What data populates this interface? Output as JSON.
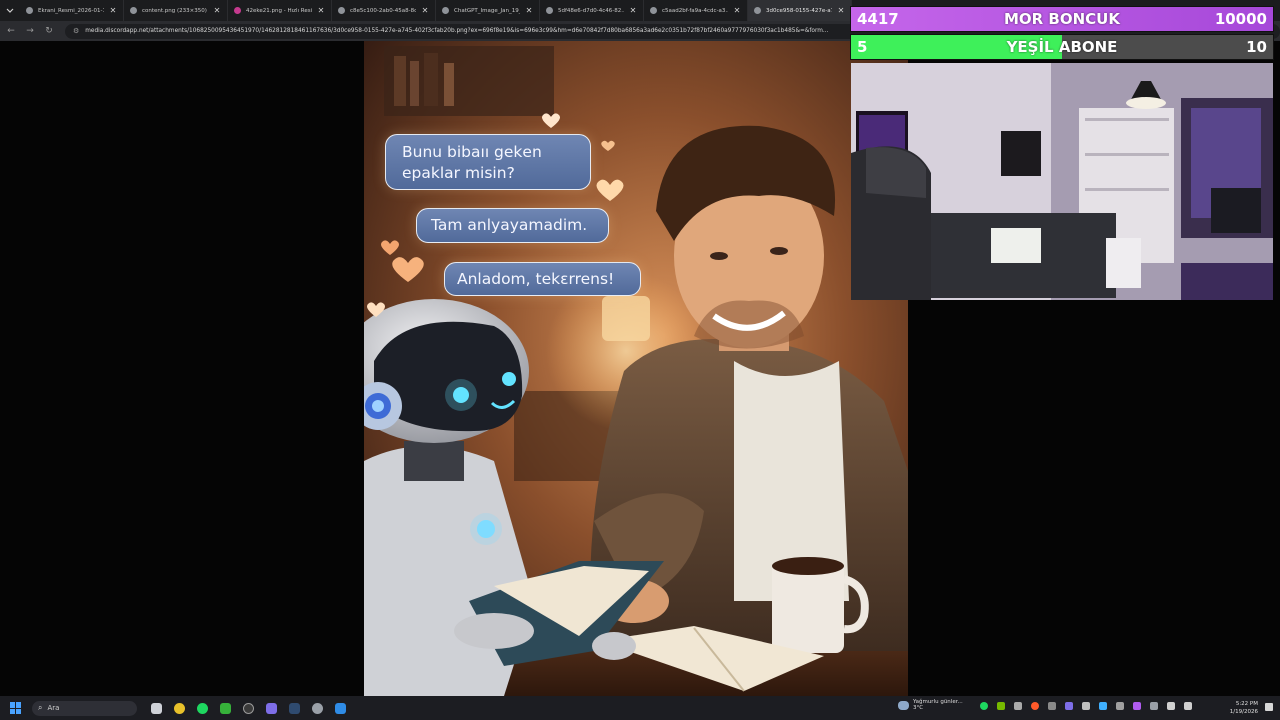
{
  "browser": {
    "tabs": [
      {
        "title": "Ekrani_Resmi_2026-01-19_...",
        "favicon_color": "#8f9399"
      },
      {
        "title": "content.png (233×350)",
        "favicon_color": "#8f9399"
      },
      {
        "title": "42eke21.png - Hızlı Resim",
        "favicon_color": "#c53a8e"
      },
      {
        "title": "c8e5c100-2ab0-45a8-8c...",
        "favicon_color": "#8f9399"
      },
      {
        "title": "ChatGPT_Image_Jan_19_...",
        "favicon_color": "#8f9399"
      },
      {
        "title": "5df48e6-d7d0-4c46-82...",
        "favicon_color": "#8f9399"
      },
      {
        "title": "c5aad2bf-fa9a-4cdc-a3...",
        "favicon_color": "#8f9399"
      },
      {
        "title": "3d0ce958-0155-427e-a7...",
        "favicon_color": "#8f9399"
      }
    ],
    "url": "media.discordapp.net/attachments/1068250095436451970/1462812818461167636/3d0ce958-0155-427e-a745-402f3cfab20b.png?ex=696f8e19&is=696e3c99&hm=d6e70842f7d80ba6856a3ad6e2c0351b72f87bf2460a9777976030f3ac1b485&=&form..."
  },
  "image": {
    "bubble_1": "Bunu bibaıı gekеn epaklar misin?",
    "bubble_2": "Tam anlyayamadim.",
    "bubble_3": "Anladom, tekεrrens!"
  },
  "overlay": {
    "mor": {
      "left": "4417",
      "label": "MOR BONCUK",
      "right": "10000",
      "fill_fraction": 0.4417
    },
    "yesil": {
      "left": "5",
      "label": "YEŞİL ABONE",
      "right": "10",
      "fill_fraction": 0.5
    }
  },
  "taskbar": {
    "search_label": "Ara",
    "weather_text": "Yağmurlu günler...",
    "weather_temp": "3°C",
    "time": "5:22 PM",
    "date": "1/19/2026"
  }
}
